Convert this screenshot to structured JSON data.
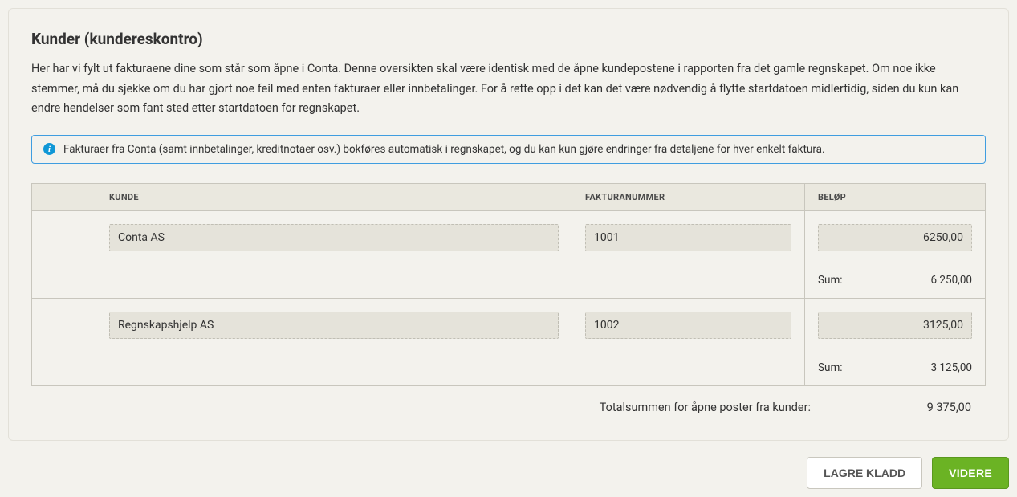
{
  "header": {
    "title": "Kunder (kundereskontro)",
    "description": "Her har vi fylt ut fakturaene dine som står som åpne i Conta. Denne oversikten skal være identisk med de åpne kundepostene i rapporten fra det gamle regnskapet. Om noe ikke stemmer, må du sjekke om du har gjort noe feil med enten fakturaer eller innbetalinger. For å rette opp i det kan det være nødvendig å flytte startdatoen midlertidig, siden du kun kan endre hendelser som fant sted etter startdatoen for regnskapet."
  },
  "info": {
    "text": "Fakturaer fra Conta (samt innbetalinger, kreditnotaer osv.) bokføres automatisk i regnskapet, og du kan kun gjøre endringer fra detaljene for hver enkelt faktura."
  },
  "table": {
    "headers": {
      "kunde": "KUNDE",
      "fakturanummer": "FAKTURANUMMER",
      "belop": "BELØP"
    },
    "rows": [
      {
        "kunde": "Conta AS",
        "fakturanummer": "1001",
        "belop": "6250,00",
        "sum_label": "Sum:",
        "sum": "6 250,00"
      },
      {
        "kunde": "Regnskapshjelp AS",
        "fakturanummer": "1002",
        "belop": "3125,00",
        "sum_label": "Sum:",
        "sum": "3 125,00"
      }
    ]
  },
  "total": {
    "label": "Totalsummen for åpne poster fra kunder:",
    "value": "9 375,00"
  },
  "actions": {
    "save_draft": "LAGRE KLADD",
    "next": "VIDERE"
  }
}
